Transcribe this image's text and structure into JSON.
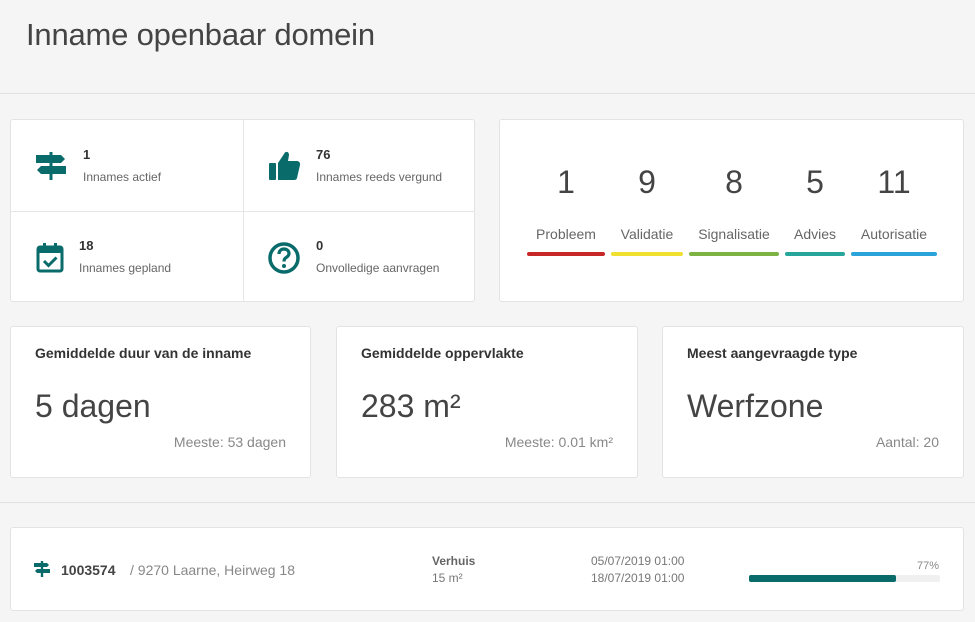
{
  "header": {
    "title": "Inname openbaar domein"
  },
  "stats": [
    {
      "icon": "signpost-icon",
      "value": "1",
      "label": "Innames actief"
    },
    {
      "icon": "thumbs-up-icon",
      "value": "76",
      "label": "Innames reeds vergund"
    },
    {
      "icon": "calendar-check-icon",
      "value": "18",
      "label": "Innames gepland"
    },
    {
      "icon": "question-circle-icon",
      "value": "0",
      "label": "Onvolledige aanvragen"
    }
  ],
  "status": [
    {
      "count": "1",
      "label": "Probleem",
      "color": "#c62828"
    },
    {
      "count": "9",
      "label": "Validatie",
      "color": "#f0e030"
    },
    {
      "count": "8",
      "label": "Signalisatie",
      "color": "#7cb342"
    },
    {
      "count": "5",
      "label": "Advies",
      "color": "#26a69a"
    },
    {
      "count": "11",
      "label": "Autorisatie",
      "color": "#29a3d9"
    }
  ],
  "metrics": [
    {
      "title": "Gemiddelde duur van de inname",
      "value": "5 dagen",
      "sub": "Meeste: 53 dagen"
    },
    {
      "title": "Gemiddelde oppervlakte",
      "value": "283 m²",
      "sub": "Meeste: 0.01 km²"
    },
    {
      "title": "Meest aangevraagde type",
      "value": "Werfzone",
      "sub": "Aantal: 20"
    }
  ],
  "list": {
    "rows": [
      {
        "icon": "signpost-icon",
        "id": "1003574",
        "address": "/ 9270 Laarne, Heirweg 18",
        "type": "Verhuis",
        "area": "15 m²",
        "start": "05/07/2019 01:00",
        "end": "18/07/2019 01:00",
        "progress_label": "77%",
        "progress": 0.77
      }
    ]
  },
  "colors": {
    "accent": "#0a6b6b"
  }
}
